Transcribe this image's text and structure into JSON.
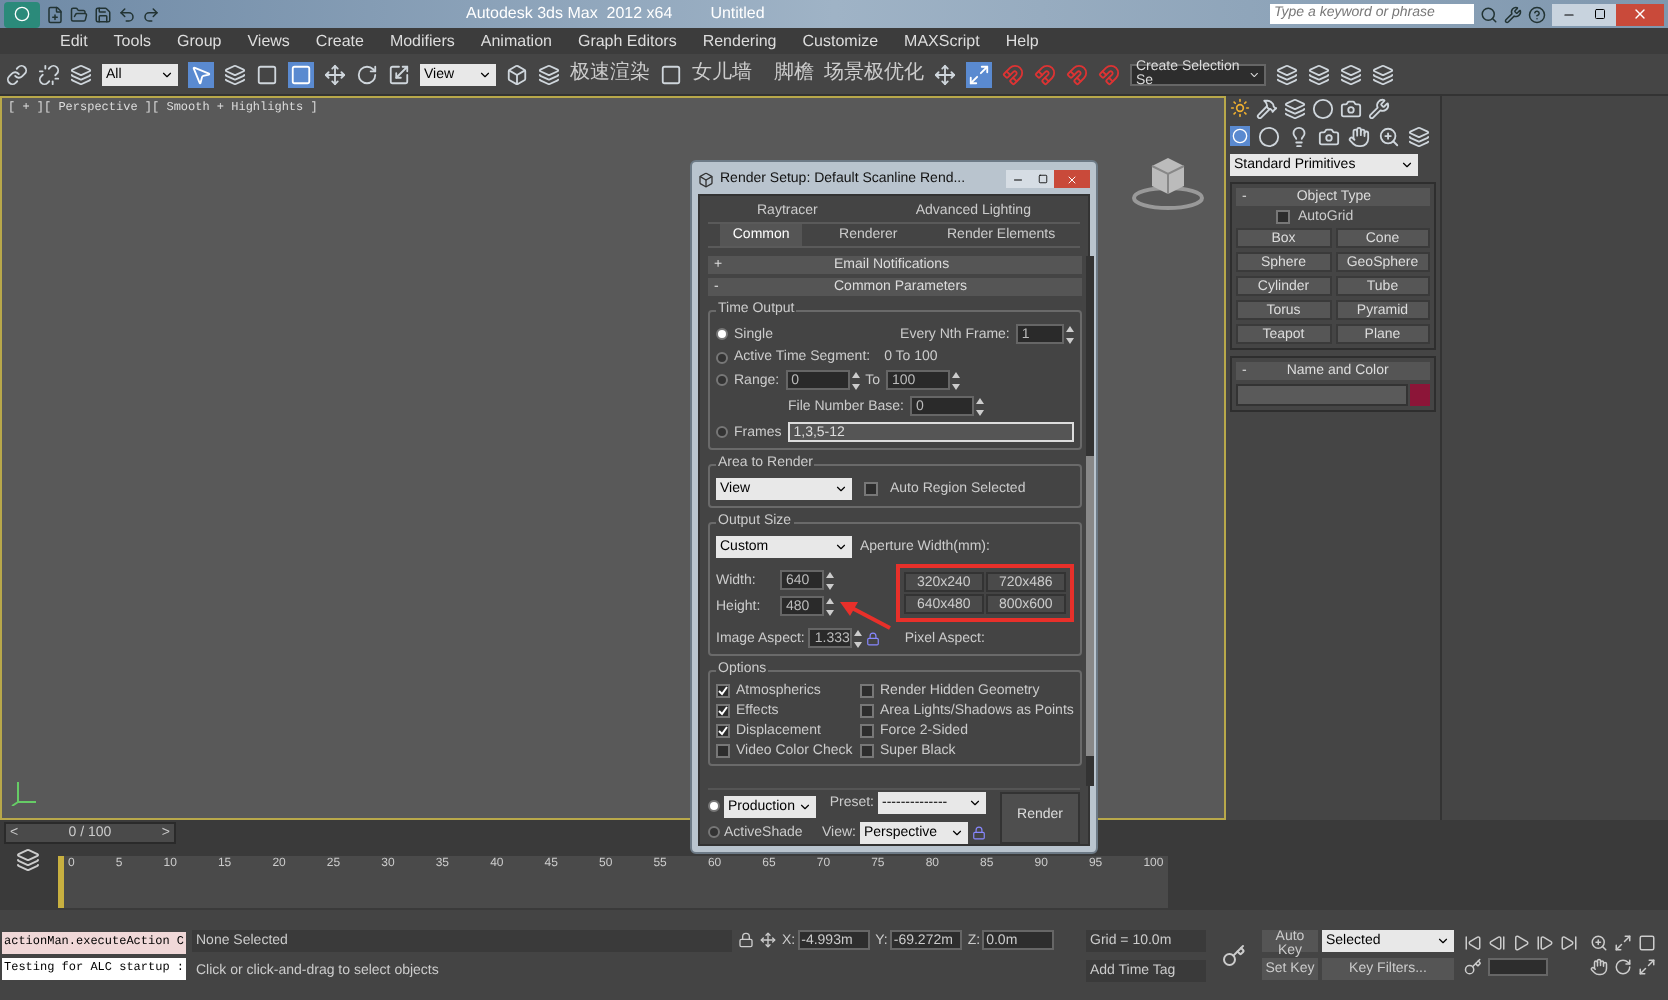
{
  "title_bar": {
    "app_title": "Autodesk 3ds Max  2012 x64",
    "document": "Untitled",
    "search": {
      "placeholder": "Type a keyword or phrase"
    }
  },
  "menu": [
    "Edit",
    "Tools",
    "Group",
    "Views",
    "Create",
    "Modifiers",
    "Animation",
    "Graph Editors",
    "Rendering",
    "Customize",
    "MAXScript",
    "Help"
  ],
  "toolbar": {
    "selection_filter": "All",
    "reference_coordinate": "View",
    "plugin_labels": [
      "极速渲染",
      "女儿墙",
      "脚檐",
      "场景极优化"
    ],
    "named_selection": "Create Selection Se"
  },
  "viewport": {
    "label": "[ + ][ Perspective ][ Smooth + Highlights ]"
  },
  "command_panel": {
    "category": "Standard Primitives",
    "object_type": {
      "sign": "-",
      "title": "Object Type",
      "autogrid": {
        "label": "AutoGrid",
        "checked": false
      },
      "buttons": [
        "Box",
        "Cone",
        "Sphere",
        "GeoSphere",
        "Cylinder",
        "Tube",
        "Torus",
        "Pyramid",
        "Teapot",
        "Plane"
      ]
    },
    "name_and_color": {
      "sign": "-",
      "title": "Name and Color"
    }
  },
  "render_setup": {
    "title": "Render Setup: Default Scanline Rend...",
    "tab_rows": [
      [
        {
          "label": "Raytracer",
          "selected": false
        },
        {
          "label": "Advanced Lighting",
          "selected": false
        }
      ],
      [
        {
          "label": "Common",
          "selected": true
        },
        {
          "label": "Renderer",
          "selected": false
        },
        {
          "label": "Render Elements",
          "selected": false
        }
      ]
    ],
    "rollouts": [
      {
        "sign": "+",
        "title": "Email Notifications"
      },
      {
        "sign": "-",
        "title": "Common Parameters"
      }
    ],
    "time_output": {
      "title": "Time Output",
      "single": {
        "label": "Single",
        "selected": true
      },
      "every_nth": {
        "label": "Every Nth Frame:",
        "value": "1"
      },
      "active_segment": {
        "label": "Active Time Segment:",
        "selected": false,
        "value": "0 To 100"
      },
      "range": {
        "label": "Range:",
        "selected": false,
        "from": "0",
        "to_label": "To",
        "to": "100"
      },
      "file_number_base": {
        "label": "File Number Base:",
        "value": "0"
      },
      "frames": {
        "label": "Frames",
        "selected": false,
        "value": "1,3,5-12"
      }
    },
    "area_to_render": {
      "title": "Area to Render",
      "mode": "View",
      "auto_region": {
        "label": "Auto Region Selected",
        "checked": false
      }
    },
    "output_size": {
      "title": "Output Size",
      "preset": "Custom",
      "aperture_label": "Aperture Width(mm):",
      "width": {
        "label": "Width:",
        "value": "640"
      },
      "height": {
        "label": "Height:",
        "value": "480"
      },
      "presets": [
        "320x240",
        "720x486",
        "640x480",
        "800x600"
      ],
      "image_aspect": {
        "label": "Image Aspect:",
        "value": "1.333"
      },
      "pixel_aspect_label": "Pixel Aspect:"
    },
    "options": {
      "title": "Options",
      "items": [
        {
          "label": "Atmospherics",
          "checked": true
        },
        {
          "label": "Render Hidden Geometry",
          "checked": false
        },
        {
          "label": "Effects",
          "checked": true
        },
        {
          "label": "Area Lights/Shadows as Points",
          "checked": false
        },
        {
          "label": "Displacement",
          "checked": true
        },
        {
          "label": "Force 2-Sided",
          "checked": false
        },
        {
          "label": "Video Color Check",
          "checked": false
        },
        {
          "label": "Super Black",
          "checked": false
        }
      ]
    },
    "footer": {
      "modes": [
        {
          "kind": "dropdown",
          "label": "Production",
          "selected": true
        },
        {
          "kind": "label",
          "label": "ActiveShade",
          "selected": false
        }
      ],
      "preset_label": "Preset:",
      "preset_value": "--------------",
      "view_label": "View:",
      "view_value": "Perspective",
      "render": "Render"
    }
  },
  "timeline": {
    "prev": "<",
    "frame_counter": "0 / 100",
    "next": ">",
    "ticks": [
      "0",
      "5",
      "10",
      "15",
      "20",
      "25",
      "30",
      "35",
      "40",
      "45",
      "50",
      "55",
      "60",
      "65",
      "70",
      "75",
      "80",
      "85",
      "90",
      "95",
      "100"
    ]
  },
  "status_bar": {
    "script_lines": [
      "actionMan.executeAction C",
      "Testing for ALC startup :"
    ],
    "selection": "None Selected",
    "prompt": "Click or click-and-drag to select objects",
    "coords": [
      {
        "axis": "X:",
        "value": "-4.993m"
      },
      {
        "axis": "Y:",
        "value": "-69.272m"
      },
      {
        "axis": "Z:",
        "value": "0.0m"
      }
    ],
    "grid": "Grid = 10.0m",
    "add_time_tag": "Add Time Tag",
    "auto_key": "Auto Key",
    "key_mode": "Selected",
    "set_key": "Set Key",
    "key_filters": "Key Filters..."
  }
}
